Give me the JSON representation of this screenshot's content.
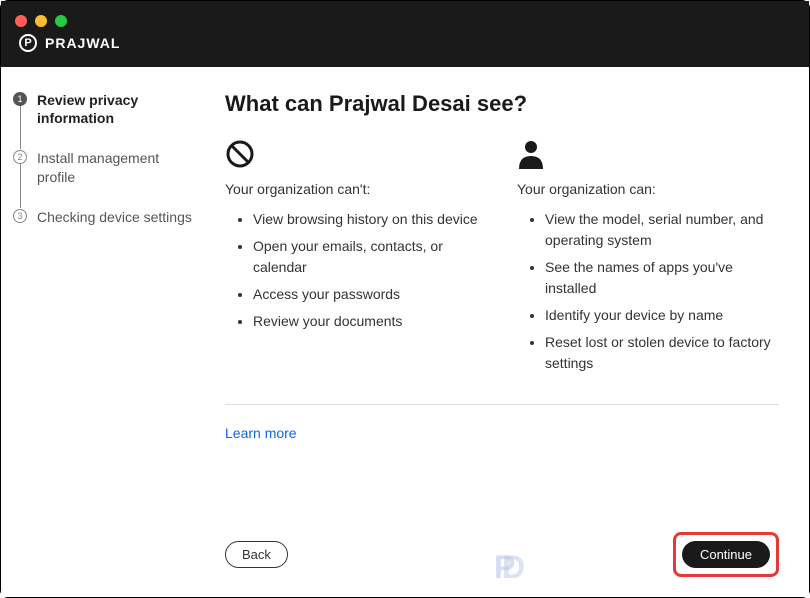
{
  "brand": {
    "name": "PRAJWAL",
    "icon_letter": "P"
  },
  "sidebar": {
    "steps": [
      {
        "num": "1",
        "label": "Review privacy information",
        "active": true
      },
      {
        "num": "2",
        "label": "Install management profile",
        "active": false
      },
      {
        "num": "3",
        "label": "Checking device settings",
        "active": false
      }
    ]
  },
  "main": {
    "heading": "What can Prajwal Desai see?",
    "cant": {
      "title": "Your organization can't:",
      "items": [
        "View browsing history on this device",
        "Open your emails, contacts, or calendar",
        "Access your passwords",
        "Review your documents"
      ]
    },
    "can": {
      "title": "Your organization can:",
      "items": [
        "View the model, serial number, and operating system",
        "See the names of apps you've installed",
        "Identify your device by name",
        "Reset lost or stolen device to factory settings"
      ]
    },
    "learn_more_label": "Learn more"
  },
  "footer": {
    "back_label": "Back",
    "continue_label": "Continue"
  }
}
